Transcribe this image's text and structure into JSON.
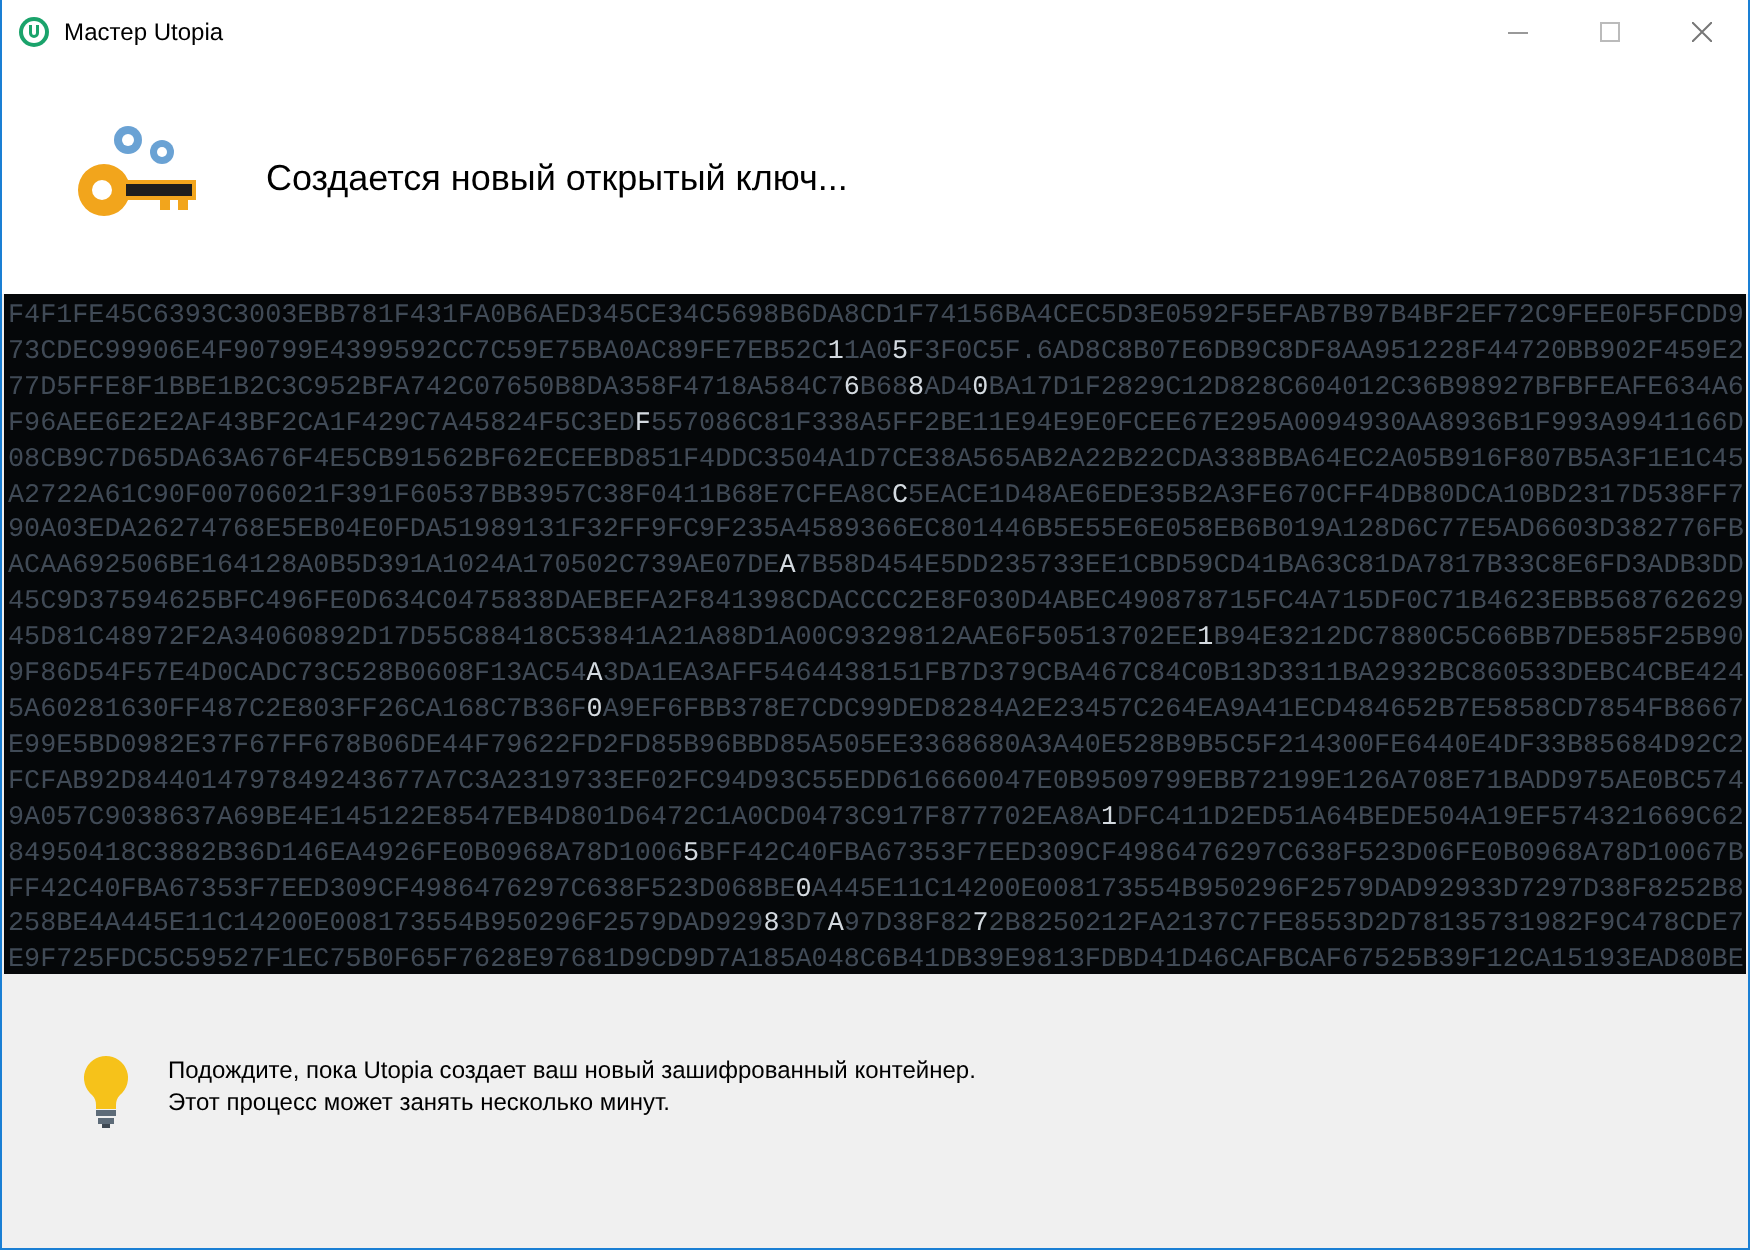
{
  "window": {
    "title": "Мастер Utopia"
  },
  "header": {
    "title": "Создается новый открытый ключ..."
  },
  "key_stream": {
    "lines": [
      "F4F1FE45C6393C3003EBB781F431FA0B6AED345CE34C5698B6DA8CD1F74156BA4CEC5D3E0592F5EFAB7B97B4BF2EF72C9FEE0F5FCDD9",
      "73CDEC99906E4F90799E4399592CC7C59E75BA0AC89FE7EB52C**1**1A0**5**F3F0C5F.6AD8C8B07E6DB9C8DF8AA951228F44720BB902F459E2",
      "77D5FFE8F1BBE1B2C3C952BFA742C07650B8DA358F4718A584C7**6**B68**8**AD4**0**BA17D1F2829C12D828C604012C36B98927BFBFEAFE634A6",
      "F96AEE6E2E2AF43BF2CA1F429C7A45824F5C3ED**F**557086C81F338A5FF2BE11E94E9E0FCEE67E295A0094930AA8936B1F993A9941166D",
      "08CB9C7D65DA63A676F4E5CB91562BF62ECEEBD851F4DDC3504A1D7CE38A565AB2A22B22CDA338BBA64EC2A05B916F807B5A3F1E1C45",
      "A2722A61C90F00706021F391F60537BB3957C38F0411B68E7CFEA8C**C**5EACE1D48AE6EDE35B2A3FE670CFF4DB80DCA10BD2317D538FF7",
      "90A03EDA26274768E5EB04E0FDA51989131F32FF9FC9F235A4589366EC801446B5E55E6E058EB6B019A128D6C77E5AD6603D382776FB",
      "ACAA692506BE164128A0B5D391A1024A170502C739AE07DE**A**7B58D454E5DD235733EE1CBD59CD41BA63C81DA7817B33C8E6FD3ADB3DD",
      "45C9D37594625BFC496FE0D634C0475838DAEBEFA2F841398CDACCCC2E8F030D4ABEC490878715FC4A715DF0C71B4623EBB568762629",
      "45D81C48972F2A34060892D17D55C88418C53841A21A88D1A00C9329812AAE6F50513702EE**1**B94E3212DC7880C5C66BB7DE585F25B90",
      "9F86D54F57E4D0CADC73C528B0608F13AC54**A**3DA1EA3AFF5464438151FB7D379CBA467C84C0B13D3311BA2932BC860533DEBC4CBE424",
      "5A60281630FF487C2E803FF26CA168C7B36F**0**A9EF6FBB378E7CDC99DED8284A2E23457C264EA9A41ECD484652B7E5858CD7854FB8667",
      "E99E5BD0982E37F67FF678B06DE44F79622FD2FD85B96BBD85A505EE3368680A3A40E528B9B5C5F214300FE6440E4DF33B85684D92C2",
      "FCFAB92D844014797849243677A7C3A2319733EF02FC94D93C55EDD616660047E0B9509799EBB72199E126A708E71BADD975AE0BC574",
      "9A057C9038637A69BE4E145122E8547EB4D801D6472C1A0CD0473C917F877702EA8A**1**DFC411D2ED51A64BEDE504A19EF574321669C62",
      "84950418C3882B36D146EA4926FE0B0968A78D1006**5**BFF42C40FBA67353F7EED309CF4986476297C638F523D06FE0B0968A78D10067B",
      "FF42C40FBA67353F7EED309CF4986476297C638F523D068BE**0**A445E11C14200E008173554B950296F2579DAD92933D7297D38F8252B8",
      "258BE4A445E11C14200E008173554B950296F2579DAD929**8**3D7**A**97D38F82**7**2B8250212FA2137C7FE8553D2D78135731982F9C478CDE7",
      "E9F725FDC5C59527F1EC75B0F65F7628E97681D9CD9D7A185A048C6B41DB39E9813FDBD41D46CAFBCAF67525B39F12CA15193EAD80BE"
    ]
  },
  "footer": {
    "message_lines": [
      "Подождите, пока Utopia создает ваш новый зашифрованный контейнер.",
      "Этот процесс может занять несколько минут."
    ]
  }
}
